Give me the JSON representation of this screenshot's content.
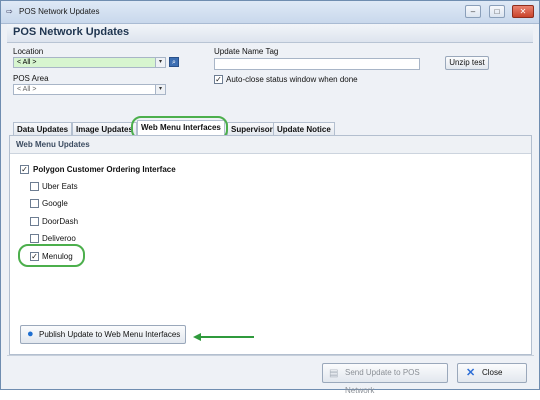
{
  "window": {
    "title": "POS Network Updates"
  },
  "header": {
    "title": "POS Network Updates"
  },
  "location": {
    "label": "Location",
    "value": "< All >"
  },
  "pos_area": {
    "label": "POS Area",
    "value": "< All >"
  },
  "update_name": {
    "label": "Update Name Tag",
    "value": ""
  },
  "unzip_button": "Unzip test",
  "auto_close": {
    "label": "Auto-close status window when done",
    "checked": true
  },
  "tabs": [
    {
      "label": "Data Updates",
      "active": false
    },
    {
      "label": "Image Updates",
      "active": false
    },
    {
      "label": "Web Menu Interfaces",
      "active": true
    },
    {
      "label": "Supervisor",
      "active": false
    },
    {
      "label": "Update Notice",
      "active": false
    }
  ],
  "section": {
    "title": "Web Menu Updates"
  },
  "parent_option": {
    "label": "Polygon Customer Ordering Interface",
    "checked": true
  },
  "options": [
    {
      "label": "Uber Eats",
      "checked": false
    },
    {
      "label": "Google",
      "checked": false
    },
    {
      "label": "DoorDash",
      "checked": false
    },
    {
      "label": "Deliveroo",
      "checked": false
    },
    {
      "label": "Menulog",
      "checked": true
    }
  ],
  "publish_button": "Publish Update to Web Menu Interfaces",
  "footer": {
    "send_button": "Send Update to POS Network",
    "close_button": "Close"
  },
  "colors": {
    "highlight": "#4caf4c",
    "location_bg": "#d7f5cf"
  }
}
